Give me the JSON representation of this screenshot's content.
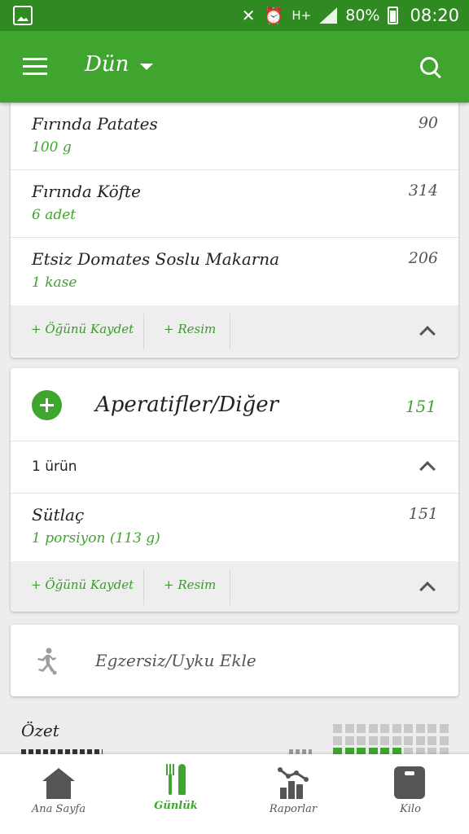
{
  "status_bar": {
    "battery_percent": "80%",
    "time": "08:20",
    "network": "H+"
  },
  "app_bar": {
    "day_selector": "Dün"
  },
  "top_card": {
    "items": [
      {
        "name": "Fırında Patates",
        "qty": "100 g",
        "cal": "90"
      },
      {
        "name": "Fırında Köfte",
        "qty": "6 adet",
        "cal": "314"
      },
      {
        "name": "Etsiz Domates Soslu Makarna",
        "qty": "1 kase",
        "cal": "206"
      }
    ],
    "actions": {
      "save_meal": "+ Öğünü Kaydet",
      "add_photo": "+ Resim"
    }
  },
  "snacks_card": {
    "title": "Aperatifler/Diğer",
    "calories": "151",
    "item_count": "1 ürün",
    "items": [
      {
        "name": "Sütlaç",
        "qty": "1 porsiyon (113 g)",
        "cal": "151"
      }
    ],
    "actions": {
      "save_meal": "+ Öğünü Kaydet",
      "add_photo": "+ Resim"
    }
  },
  "exercise_card": {
    "label": "Egzersiz/Uyku Ekle"
  },
  "summary": {
    "title": "Özet",
    "blocks_filled_row2": 6
  },
  "bottom_nav": {
    "items": [
      {
        "label": "Ana Sayfa",
        "icon": "home-icon",
        "active": false
      },
      {
        "label": "Günlük",
        "icon": "cutlery-icon",
        "active": true
      },
      {
        "label": "Raporlar",
        "icon": "reports-icon",
        "active": false
      },
      {
        "label": "Kilo",
        "icon": "scale-icon",
        "active": false
      }
    ]
  },
  "colors": {
    "brand_green": "#3fa52e",
    "status_green": "#2f8a22"
  }
}
